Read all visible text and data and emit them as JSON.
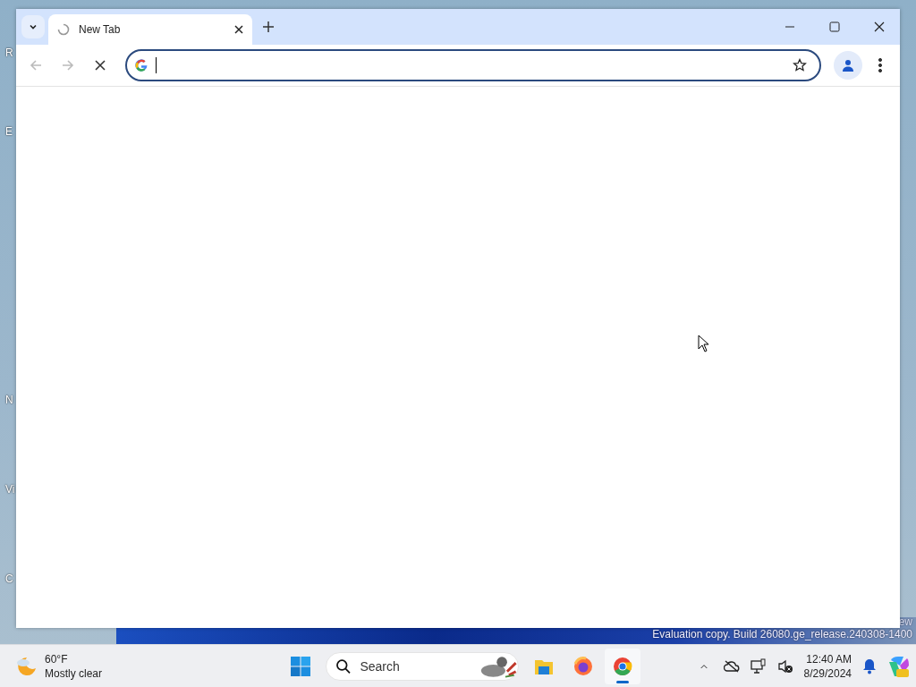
{
  "desktop": {
    "icon_labels": [
      "R",
      "E",
      "N",
      "Vi",
      "C"
    ],
    "watermark": [
      "ew",
      "Evaluation copy. Build 26080.ge_release.240308-1400"
    ]
  },
  "browser": {
    "tabs": [
      {
        "title": "New Tab",
        "selected": true,
        "loading": true
      }
    ],
    "back_disabled": true,
    "forward_disabled": true
  },
  "taskbar": {
    "weather": {
      "temperature": "60°F",
      "condition": "Mostly clear"
    },
    "search": {
      "placeholder": "Search"
    },
    "apps": [
      {
        "kind": "files",
        "running": false
      },
      {
        "kind": "firefox",
        "running": false
      },
      {
        "kind": "chrome",
        "running": true
      }
    ],
    "clock": {
      "time": "12:40 AM",
      "date": "8/29/2024"
    }
  }
}
